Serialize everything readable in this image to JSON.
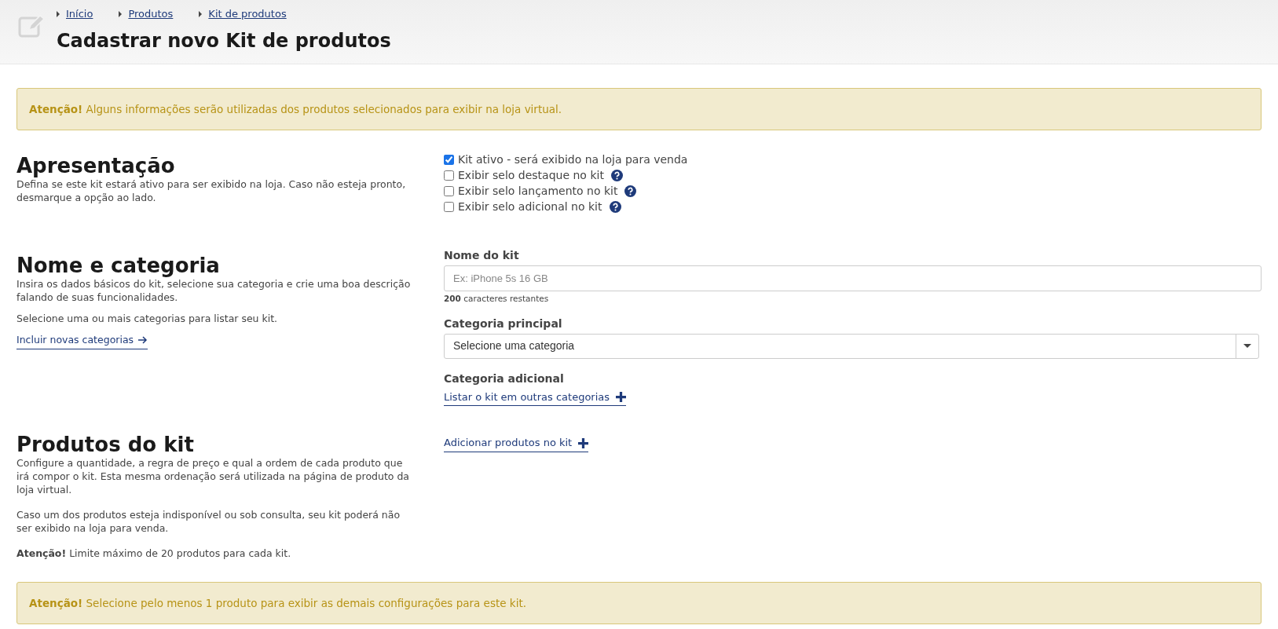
{
  "header": {
    "breadcrumbs": [
      "Início",
      "Produtos",
      "Kit de produtos"
    ],
    "title": "Cadastrar novo Kit de produtos"
  },
  "top_alert": "**Atenção!** Alguns informações serão utilizadas dos produtos selecionados para exibir na loja virtual.",
  "presentation": {
    "title": "Apresentação",
    "description": "Defina se este kit estará ativo para ser exibido na loja. Caso não esteja pronto, desmarque a opção ao lado.",
    "options": [
      {
        "label": "Kit ativo - será exibido na loja para venda",
        "checked": true,
        "help": false
      },
      {
        "label": "Exibir selo destaque no kit",
        "checked": false,
        "help": true
      },
      {
        "label": "Exibir selo lançamento no kit",
        "checked": false,
        "help": true
      },
      {
        "label": "Exibir selo adicional no kit",
        "checked": false,
        "help": true
      }
    ]
  },
  "name_category": {
    "title": "Nome e categoria",
    "paragraphs": [
      "Insira os dados básicos do kit, selecione sua categoria e crie uma boa descrição falando de suas funcionalidades.",
      "Selecione uma ou mais categorias para listar seu kit."
    ],
    "link": "Incluir novas categorias",
    "name_label": "Nome do kit",
    "name_placeholder": "Ex: iPhone 5s 16 GB",
    "remaining": "**200** caracteres restantes",
    "main_category_label": "Categoria principal",
    "main_category_value": "Selecione uma categoria",
    "additional_label": "Categoria adicional",
    "additional_link": "Listar o kit em outras categorias"
  },
  "products": {
    "title": "Produtos do kit",
    "paragraphs": [
      "Configure a quantidade, a regra de preço e qual a ordem de cada produto que irá compor o kit. Esta mesma ordenação será utilizada na página de produto da loja virtual.",
      "Caso um dos produtos esteja indisponível ou sob consulta, seu kit poderá não ser exibido na loja para venda.",
      "**Atenção!** Limite máximo de 20 produtos para cada kit."
    ],
    "add_link": "Adicionar produtos no kit"
  },
  "bottom_alert": "**Atenção!** Selecione pelo menos 1 produto para exibir as demais configurações para este kit."
}
